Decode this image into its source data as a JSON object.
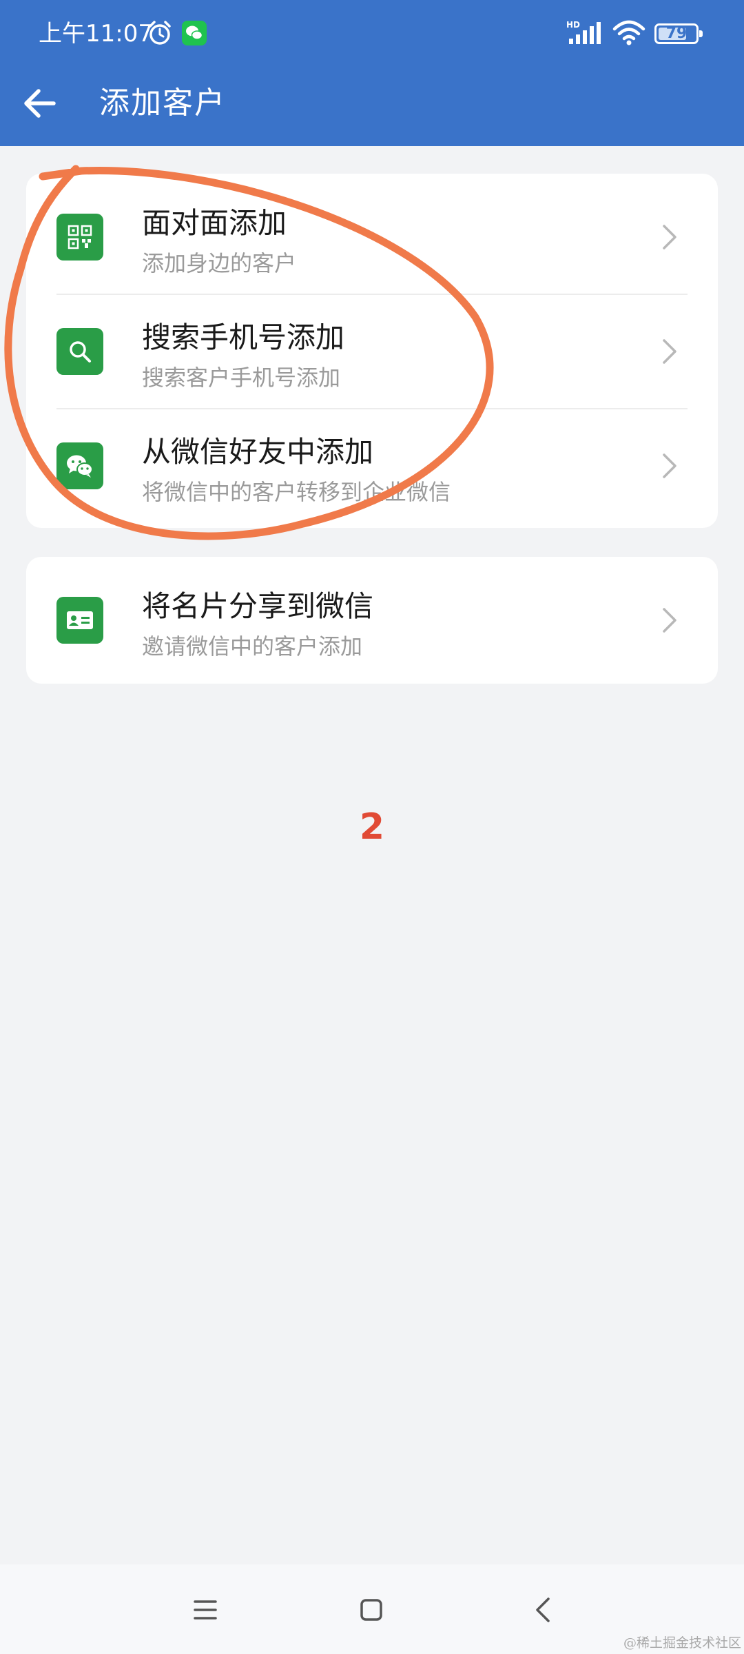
{
  "status_bar": {
    "time": "上午11:07",
    "network": "HD",
    "battery": "79",
    "battery_level": 0.79
  },
  "header": {
    "title": "添加客户",
    "bg_color": "#3a73c9"
  },
  "groups": [
    {
      "items": [
        {
          "title": "面对面添加",
          "subtitle": "添加身边的客户",
          "icon": "qr-code-icon"
        },
        {
          "title": "搜索手机号添加",
          "subtitle": "搜索客户手机号添加",
          "icon": "search-icon"
        },
        {
          "title": "从微信好友中添加",
          "subtitle": "将微信中的客户转移到企业微信",
          "icon": "wechat-icon"
        }
      ]
    },
    {
      "items": [
        {
          "title": "将名片分享到微信",
          "subtitle": "邀请微信中的客户添加",
          "icon": "business-card-icon"
        }
      ]
    }
  ],
  "annotation": {
    "number": "2",
    "color": "#e14a35",
    "circle_color": "#f07a4a"
  },
  "icon_color": "#2a9d47",
  "watermark": "@稀土掘金技术社区"
}
